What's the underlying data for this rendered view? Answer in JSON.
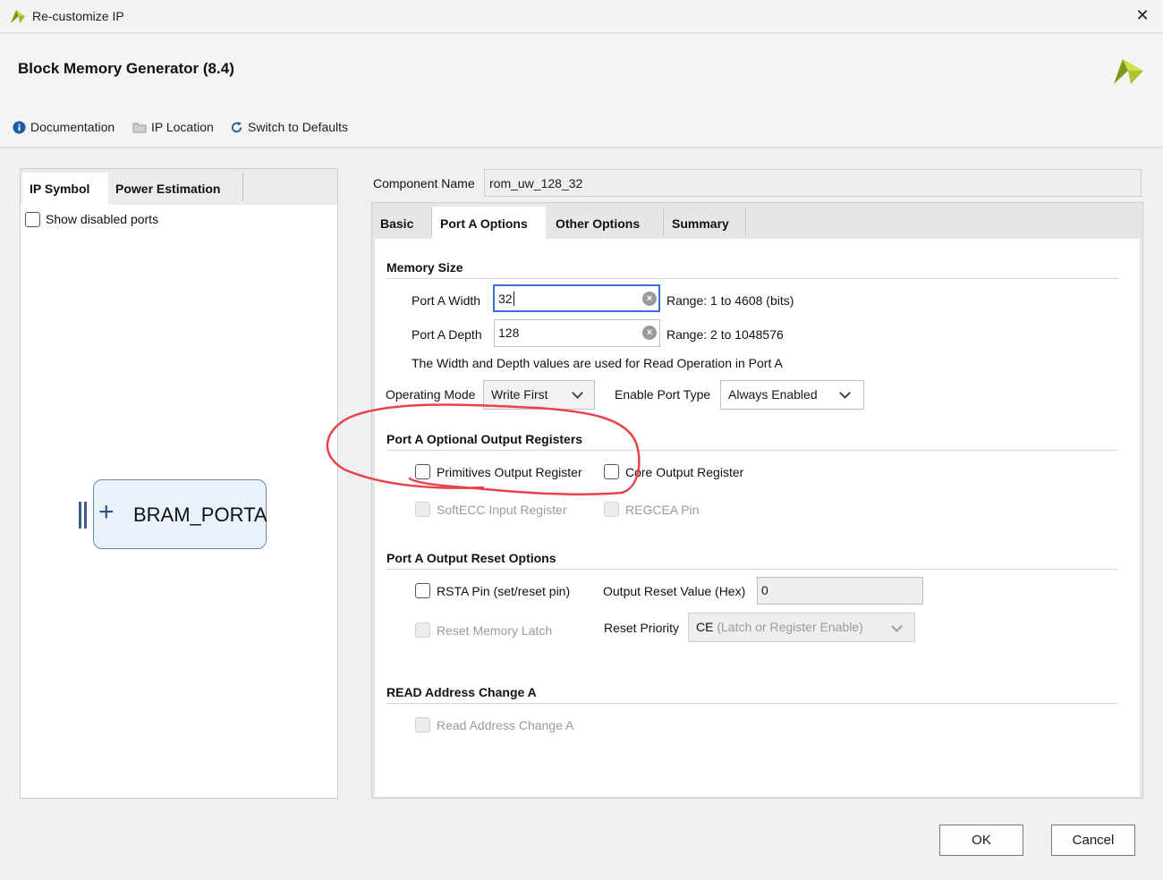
{
  "window": {
    "title": "Re-customize IP",
    "close_glyph": "✕"
  },
  "header": {
    "ip_name": "Block Memory Generator (8.4)"
  },
  "toolbar": {
    "documentation": "Documentation",
    "ip_location": "IP Location",
    "switch_defaults": "Switch to Defaults"
  },
  "left_panel": {
    "tabs": [
      "IP Symbol",
      "Power Estimation"
    ],
    "show_disabled_ports": "Show disabled ports",
    "symbol": {
      "port_label": "BRAM_PORTA",
      "expand_glyph": "+"
    }
  },
  "component": {
    "label": "Component Name",
    "value": "rom_uw_128_32"
  },
  "tabs": [
    "Basic",
    "Port A Options",
    "Other Options",
    "Summary"
  ],
  "memory_size": {
    "title": "Memory Size",
    "width": {
      "label": "Port A Width",
      "value": "32",
      "range": "Range: 1 to 4608 (bits)"
    },
    "depth": {
      "label": "Port A Depth",
      "value": "128",
      "range": "Range: 2 to 1048576"
    },
    "note": "The Width and Depth values are used for Read Operation in Port A"
  },
  "operating_mode": {
    "label": "Operating Mode",
    "value": "Write First"
  },
  "enable_port_type": {
    "label": "Enable Port Type",
    "value": "Always Enabled"
  },
  "optional_regs": {
    "title": "Port A Optional Output Registers",
    "primitives": "Primitives Output Register",
    "core": "Core Output Register",
    "softecc": "SoftECC Input Register",
    "regcea": "REGCEA Pin"
  },
  "reset_opts": {
    "title": "Port A Output Reset Options",
    "rsta": "RSTA Pin (set/reset pin)",
    "reset_value_label": "Output Reset Value (Hex)",
    "reset_value": "0",
    "reset_latch": "Reset Memory Latch",
    "reset_priority_label": "Reset Priority",
    "reset_priority_value_main": "CE",
    "reset_priority_value_rest": "(Latch or Register Enable)"
  },
  "read_addr": {
    "title": "READ Address Change A",
    "checkbox": "Read Address Change A"
  },
  "buttons": {
    "ok": "OK",
    "cancel": "Cancel"
  },
  "colors": {
    "annotation": "#e8434b",
    "accent": "#3d6fd0",
    "brand_green": "#7a9a1a",
    "brand_yellow": "#c7d84a"
  }
}
